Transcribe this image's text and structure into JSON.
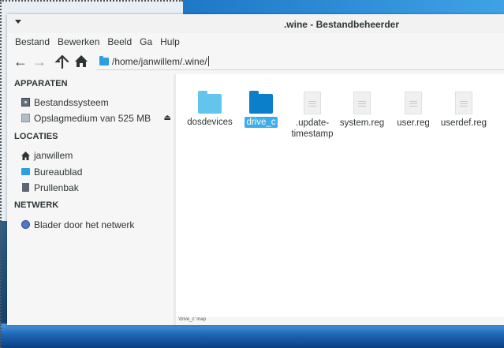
{
  "window": {
    "title": ".wine - Bestandbeheerder"
  },
  "menubar": [
    "Bestand",
    "Bewerken",
    "Beeld",
    "Ga",
    "Hulp"
  ],
  "toolbar": {
    "path": "/home/janwillem/.wine/"
  },
  "sidebar": {
    "sections": [
      {
        "title": "APPARATEN",
        "items": [
          {
            "label": "Bestandssysteem",
            "icon": "drive-icon"
          },
          {
            "label": "Opslagmedium van 525 MB",
            "icon": "usb-drive-icon",
            "eject": "⏏"
          }
        ]
      },
      {
        "title": "LOCATIES",
        "items": [
          {
            "label": "janwillem",
            "icon": "home-icon"
          },
          {
            "label": "Bureaublad",
            "icon": "desktop-icon"
          },
          {
            "label": "Prullenbak",
            "icon": "trash-icon"
          }
        ]
      },
      {
        "title": "NETWERK",
        "items": [
          {
            "label": "Blader door het netwerk",
            "icon": "network-icon"
          }
        ]
      }
    ]
  },
  "files": [
    {
      "name": "dosdevices",
      "type": "folder",
      "color": "#63c4ee"
    },
    {
      "name": "drive_c",
      "type": "folder",
      "color": "#0b7fc9",
      "selected": true
    },
    {
      "name": ".update-timestamp",
      "line1": ".update-",
      "line2": "timestamp",
      "type": "document"
    },
    {
      "name": "system.reg",
      "type": "document"
    },
    {
      "name": "user.reg",
      "type": "document"
    },
    {
      "name": "userdef.reg",
      "type": "document"
    }
  ],
  "statusbar": {
    "text": "'drive_c' map"
  },
  "colors": {
    "selection": "#3daee9",
    "folder_light": "#63c4ee",
    "folder_dark": "#0b7fc9"
  }
}
